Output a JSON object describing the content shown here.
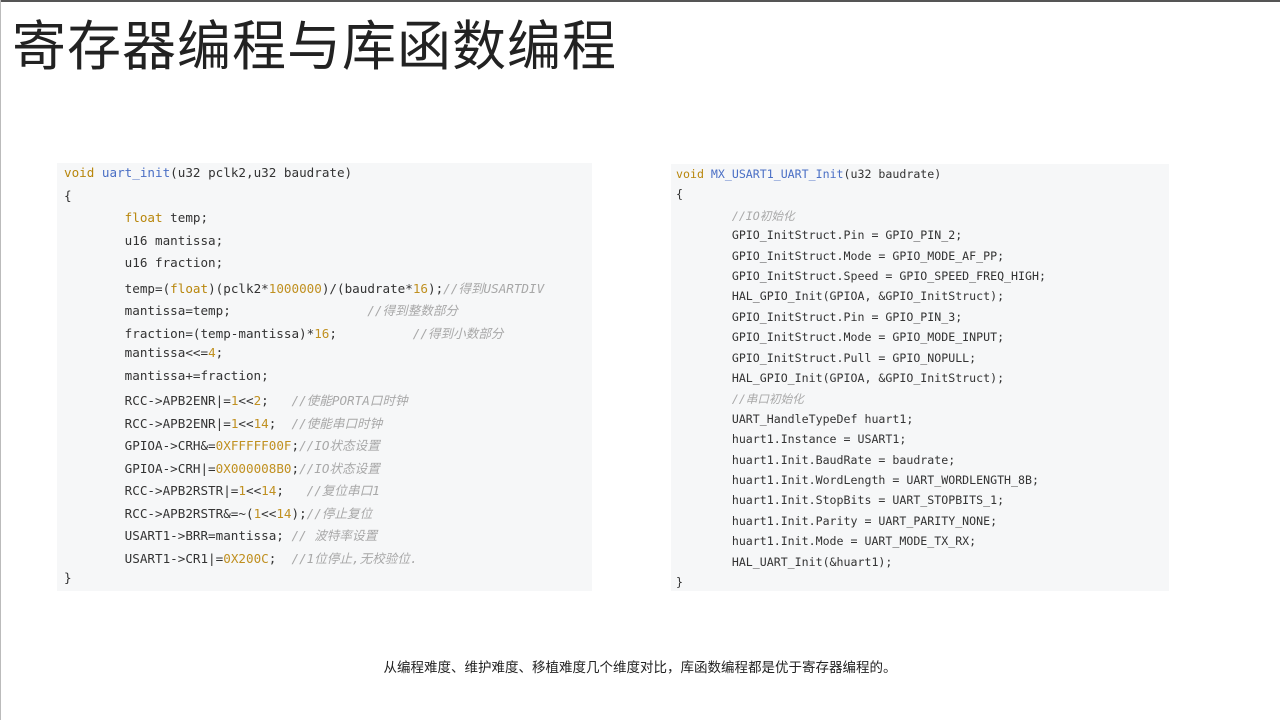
{
  "title": "寄存器编程与库函数编程",
  "caption": "从编程难度、维护难度、移植难度几个维度对比，库函数编程都是优于寄存器编程的。",
  "left_code": {
    "lines": [
      [
        {
          "t": "void ",
          "c": "k"
        },
        {
          "t": "uart_init",
          "c": "f"
        },
        {
          "t": "(u32 pclk2,u32 baudrate)",
          "c": ""
        }
      ],
      [
        {
          "t": "{",
          "c": ""
        }
      ],
      [
        {
          "t": "        ",
          "c": ""
        },
        {
          "t": "float",
          "c": "k"
        },
        {
          "t": " temp;",
          "c": ""
        }
      ],
      [
        {
          "t": "        u16 mantissa;",
          "c": ""
        }
      ],
      [
        {
          "t": "        u16 fraction;",
          "c": ""
        }
      ],
      [
        {
          "t": "        temp=(",
          "c": ""
        },
        {
          "t": "float",
          "c": "k"
        },
        {
          "t": ")(pclk2*",
          "c": ""
        },
        {
          "t": "1000000",
          "c": "n"
        },
        {
          "t": ")/(baudrate*",
          "c": ""
        },
        {
          "t": "16",
          "c": "n"
        },
        {
          "t": ");",
          "c": ""
        },
        {
          "t": "//得到USARTDIV",
          "c": "c"
        }
      ],
      [
        {
          "t": "        mantissa=temp;                  ",
          "c": ""
        },
        {
          "t": "//得到整数部分",
          "c": "c"
        }
      ],
      [
        {
          "t": "        fraction=(temp-mantissa)*",
          "c": ""
        },
        {
          "t": "16",
          "c": "n"
        },
        {
          "t": ";          ",
          "c": ""
        },
        {
          "t": "//得到小数部分",
          "c": "c"
        }
      ],
      [
        {
          "t": "        mantissa<<=",
          "c": ""
        },
        {
          "t": "4",
          "c": "n"
        },
        {
          "t": ";",
          "c": ""
        }
      ],
      [
        {
          "t": "        mantissa+=fraction;",
          "c": ""
        }
      ],
      [
        {
          "t": "        RCC->APB2ENR|=",
          "c": ""
        },
        {
          "t": "1",
          "c": "n"
        },
        {
          "t": "<<",
          "c": ""
        },
        {
          "t": "2",
          "c": "n"
        },
        {
          "t": ";   ",
          "c": ""
        },
        {
          "t": "//使能PORTA口时钟",
          "c": "c"
        }
      ],
      [
        {
          "t": "        RCC->APB2ENR|=",
          "c": ""
        },
        {
          "t": "1",
          "c": "n"
        },
        {
          "t": "<<",
          "c": ""
        },
        {
          "t": "14",
          "c": "n"
        },
        {
          "t": ";  ",
          "c": ""
        },
        {
          "t": "//使能串口时钟",
          "c": "c"
        }
      ],
      [
        {
          "t": "        GPIOA->CRH&=",
          "c": ""
        },
        {
          "t": "0XFFFFF00F",
          "c": "n"
        },
        {
          "t": ";",
          "c": ""
        },
        {
          "t": "//IO状态设置",
          "c": "c"
        }
      ],
      [
        {
          "t": "        GPIOA->CRH|=",
          "c": ""
        },
        {
          "t": "0X000008B0",
          "c": "n"
        },
        {
          "t": ";",
          "c": ""
        },
        {
          "t": "//IO状态设置",
          "c": "c"
        }
      ],
      [
        {
          "t": "        RCC->APB2RSTR|=",
          "c": ""
        },
        {
          "t": "1",
          "c": "n"
        },
        {
          "t": "<<",
          "c": ""
        },
        {
          "t": "14",
          "c": "n"
        },
        {
          "t": ";   ",
          "c": ""
        },
        {
          "t": "//复位串口1",
          "c": "c"
        }
      ],
      [
        {
          "t": "        RCC->APB2RSTR&=~(",
          "c": ""
        },
        {
          "t": "1",
          "c": "n"
        },
        {
          "t": "<<",
          "c": ""
        },
        {
          "t": "14",
          "c": "n"
        },
        {
          "t": ");",
          "c": ""
        },
        {
          "t": "//停止复位",
          "c": "c"
        }
      ],
      [
        {
          "t": "        USART1->BRR=mantissa; ",
          "c": ""
        },
        {
          "t": "// 波特率设置",
          "c": "c"
        }
      ],
      [
        {
          "t": "        USART1->CR1|=",
          "c": ""
        },
        {
          "t": "0X200C",
          "c": "n"
        },
        {
          "t": ";  ",
          "c": ""
        },
        {
          "t": "//1位停止,无校验位.",
          "c": "c"
        }
      ],
      [
        {
          "t": "}",
          "c": ""
        }
      ]
    ]
  },
  "right_code": {
    "lines": [
      [
        {
          "t": "void ",
          "c": "k"
        },
        {
          "t": "MX_USART1_UART_Init",
          "c": "f"
        },
        {
          "t": "(u32 baudrate)",
          "c": ""
        }
      ],
      [
        {
          "t": "{",
          "c": ""
        }
      ],
      [
        {
          "t": "        ",
          "c": ""
        },
        {
          "t": "//IO初始化",
          "c": "c"
        }
      ],
      [
        {
          "t": "        GPIO_InitStruct.Pin = GPIO_PIN_2;",
          "c": ""
        }
      ],
      [
        {
          "t": "        GPIO_InitStruct.Mode = GPIO_MODE_AF_PP;",
          "c": ""
        }
      ],
      [
        {
          "t": "        GPIO_InitStruct.Speed = GPIO_SPEED_FREQ_HIGH;",
          "c": ""
        }
      ],
      [
        {
          "t": "        HAL_GPIO_Init(GPIOA, &GPIO_InitStruct);",
          "c": ""
        }
      ],
      [
        {
          "t": "        GPIO_InitStruct.Pin = GPIO_PIN_3;",
          "c": ""
        }
      ],
      [
        {
          "t": "        GPIO_InitStruct.Mode = GPIO_MODE_INPUT;",
          "c": ""
        }
      ],
      [
        {
          "t": "        GPIO_InitStruct.Pull = GPIO_NOPULL;",
          "c": ""
        }
      ],
      [
        {
          "t": "        HAL_GPIO_Init(GPIOA, &GPIO_InitStruct);",
          "c": ""
        }
      ],
      [
        {
          "t": "        ",
          "c": ""
        },
        {
          "t": "//串口初始化",
          "c": "c"
        }
      ],
      [
        {
          "t": "        UART_HandleTypeDef huart1;",
          "c": ""
        }
      ],
      [
        {
          "t": "        huart1.Instance = USART1;",
          "c": ""
        }
      ],
      [
        {
          "t": "        huart1.Init.BaudRate = baudrate;",
          "c": ""
        }
      ],
      [
        {
          "t": "        huart1.Init.WordLength = UART_WORDLENGTH_8B;",
          "c": ""
        }
      ],
      [
        {
          "t": "        huart1.Init.StopBits = UART_STOPBITS_1;",
          "c": ""
        }
      ],
      [
        {
          "t": "        huart1.Init.Parity = UART_PARITY_NONE;",
          "c": ""
        }
      ],
      [
        {
          "t": "        huart1.Init.Mode = UART_MODE_TX_RX;",
          "c": ""
        }
      ],
      [
        {
          "t": "        HAL_UART_Init(&huart1);",
          "c": ""
        }
      ],
      [
        {
          "t": "}",
          "c": ""
        }
      ]
    ]
  }
}
